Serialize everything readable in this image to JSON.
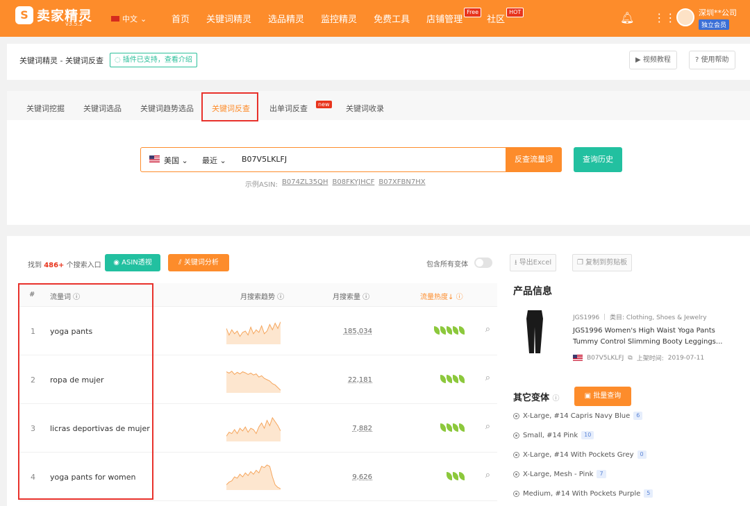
{
  "app": {
    "name": "卖家精灵",
    "version": "v3.5.2",
    "lang": "中文"
  },
  "nav": [
    {
      "label": "首页"
    },
    {
      "label": "关键词精灵"
    },
    {
      "label": "选品精灵"
    },
    {
      "label": "监控精灵"
    },
    {
      "label": "免费工具"
    },
    {
      "label": "店铺管理",
      "badge": "Free"
    },
    {
      "label": "社区",
      "badge": "HOT"
    }
  ],
  "user": {
    "company": "深圳**公司",
    "membership": "独立会员"
  },
  "header": {
    "breadcrumb": "关键词精灵 - 关键词反查",
    "plugin_tag": "插件已支持，查看介绍",
    "video_btn": "视频教程",
    "help_btn": "使用帮助"
  },
  "tabs": [
    {
      "label": "关键词挖掘"
    },
    {
      "label": "关键词选品"
    },
    {
      "label": "关键词趋势选品"
    },
    {
      "label": "关键词反查",
      "active": true
    },
    {
      "label": "出单词反查",
      "badge": "new"
    },
    {
      "label": "关键词收录"
    }
  ],
  "search": {
    "country": "美国",
    "range": "最近",
    "value": "B07V5LKLFJ",
    "submit": "反查流量词",
    "history": "查询历史",
    "example_label": "示例ASIN:",
    "examples": [
      "B074ZL35QH",
      "B08FKYJHCF",
      "B07XFBN7HX"
    ]
  },
  "results": {
    "found_prefix": "找到",
    "found_count": "486+",
    "found_suffix": "个搜索入口",
    "asin_btn": "ASIN透视",
    "kw_btn": "关键词分析",
    "variant_label": "包含所有变体",
    "export_btn": "导出Excel",
    "copy_btn": "复制到剪贴板",
    "columns": {
      "index": "#",
      "keyword": "流量词",
      "trend": "月搜索趋势",
      "volume": "月搜索量",
      "heat": "流量热度↓"
    },
    "rows": [
      {
        "index": "1",
        "keyword": "yoga pants",
        "volume": "185,034",
        "heat": 5,
        "trend": [
          0.6,
          0.35,
          0.55,
          0.4,
          0.5,
          0.3,
          0.45,
          0.5,
          0.35,
          0.65,
          0.4,
          0.55,
          0.45,
          0.7,
          0.4,
          0.5,
          0.75,
          0.55,
          0.8,
          0.6,
          0.85
        ]
      },
      {
        "index": "2",
        "keyword": "ropa de mujer",
        "volume": "22,181",
        "heat": 4,
        "trend": [
          0.8,
          0.75,
          0.82,
          0.7,
          0.78,
          0.72,
          0.8,
          0.76,
          0.7,
          0.75,
          0.68,
          0.72,
          0.6,
          0.65,
          0.55,
          0.5,
          0.45,
          0.35,
          0.3,
          0.2,
          0.1
        ]
      },
      {
        "index": "3",
        "keyword": "licras deportivas de mujer",
        "volume": "7,882",
        "heat": 4,
        "trend": [
          0.2,
          0.35,
          0.3,
          0.45,
          0.3,
          0.5,
          0.4,
          0.55,
          0.35,
          0.5,
          0.45,
          0.3,
          0.55,
          0.7,
          0.5,
          0.8,
          0.6,
          0.9,
          0.75,
          0.6,
          0.4
        ]
      },
      {
        "index": "4",
        "keyword": "yoga pants for women",
        "volume": "9,626",
        "heat": 3,
        "trend": [
          0.2,
          0.3,
          0.35,
          0.5,
          0.45,
          0.6,
          0.5,
          0.65,
          0.55,
          0.7,
          0.6,
          0.75,
          0.65,
          0.9,
          0.85,
          0.95,
          0.9,
          0.5,
          0.2,
          0.1,
          0.05
        ]
      }
    ]
  },
  "product": {
    "section_title": "产品信息",
    "sku": "JGS1996",
    "category_label": "类目:",
    "category": "Clothing, Shoes & Jewelry",
    "name": "JGS1996 Women's High Waist Yoga Pants Tummy Control Slimming Booty Leggings...",
    "asin": "B07V5LKLFJ",
    "listed_label": "上架时间:",
    "listed_date": "2019-07-11"
  },
  "variants": {
    "section_title": "其它变体",
    "batch_btn": "批量查询",
    "items": [
      {
        "label": "X-Large, #14 Capris Navy Blue",
        "count": "6"
      },
      {
        "label": "Small, #14 Pink",
        "count": "10"
      },
      {
        "label": "X-Large, #14 With Pockets Grey",
        "count": "0"
      },
      {
        "label": "X-Large, Mesh - Pink",
        "count": "7"
      },
      {
        "label": "Medium, #14 With Pockets Purple",
        "count": "5"
      }
    ]
  },
  "colors": {
    "brand": "#fd8c2b",
    "teal": "#22c0a0",
    "highlight": "#e8312b"
  }
}
